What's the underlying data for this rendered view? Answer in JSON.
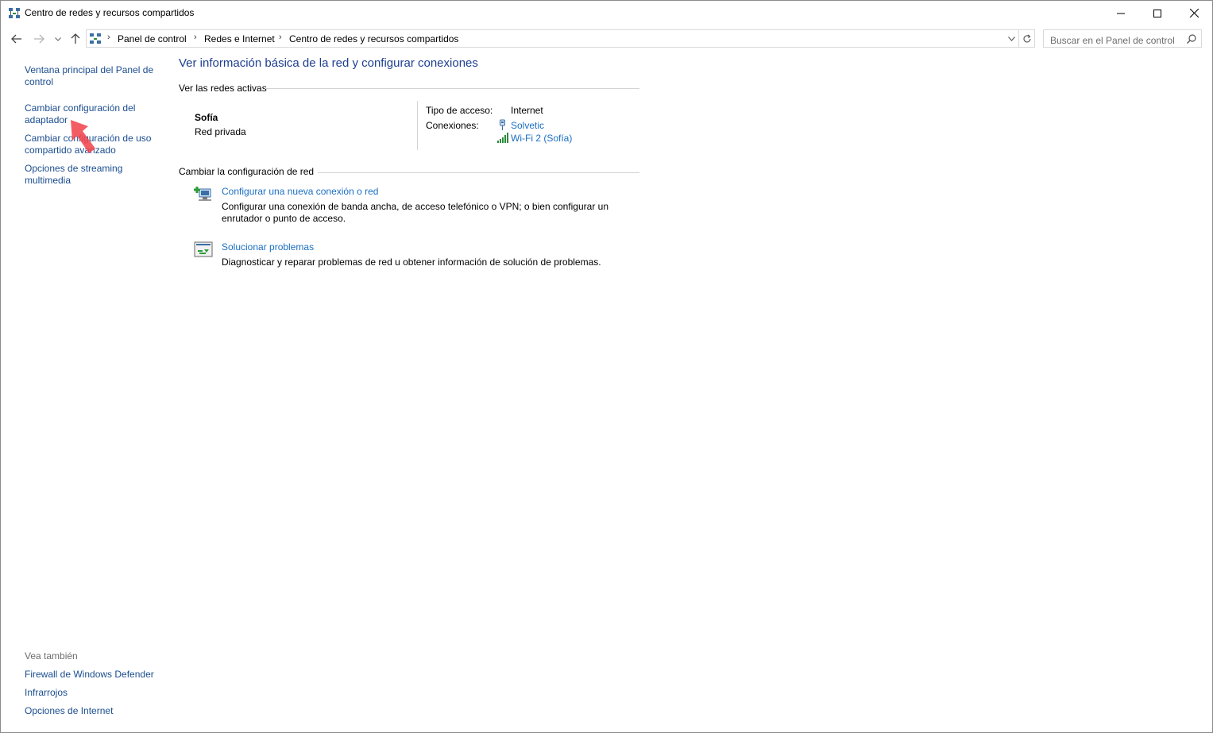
{
  "window": {
    "title": "Centro de redes y recursos compartidos"
  },
  "nav": {
    "breadcrumbs": [
      "Panel de control",
      "Redes e Internet",
      "Centro de redes y recursos compartidos"
    ],
    "search_placeholder": "Buscar en el Panel de control"
  },
  "sidebar": {
    "links": [
      {
        "label": "Ventana principal del Panel de control"
      },
      {
        "label": "Cambiar configuración del adaptador"
      },
      {
        "label": "Cambiar configuración de uso compartido avanzado"
      },
      {
        "label": "Opciones de streaming multimedia"
      }
    ],
    "see_also_heading": "Vea también",
    "see_also": [
      {
        "label": "Firewall de Windows Defender"
      },
      {
        "label": "Infrarrojos"
      },
      {
        "label": "Opciones de Internet"
      }
    ]
  },
  "main": {
    "title": "Ver información básica de la red y configurar conexiones",
    "active_networks_heading": "Ver las redes activas",
    "network": {
      "name": "Sofía",
      "category": "Red privada",
      "access_type_label": "Tipo de acceso:",
      "access_type_value": "Internet",
      "connections_label": "Conexiones:",
      "connections": [
        {
          "label": "Solvetic",
          "icon": "ethernet-icon"
        },
        {
          "label": "Wi-Fi 2 (Sofía)",
          "icon": "wifi-signal-icon"
        }
      ]
    },
    "change_settings_heading": "Cambiar la configuración de red",
    "tasks": [
      {
        "title": "Configurar una nueva conexión o red",
        "description": "Configurar una conexión de banda ancha, de acceso telefónico o VPN; o bien configurar un enrutador o punto de acceso.",
        "icon": "new-connection-icon"
      },
      {
        "title": "Solucionar problemas",
        "description": "Diagnosticar y reparar problemas de red u obtener información de solución de problemas.",
        "icon": "troubleshoot-icon"
      }
    ]
  },
  "colors": {
    "link": "#1b6fc2",
    "sidebar_link": "#1a4d8f",
    "title": "#1e3f8f",
    "annotation": "#f2464f"
  }
}
